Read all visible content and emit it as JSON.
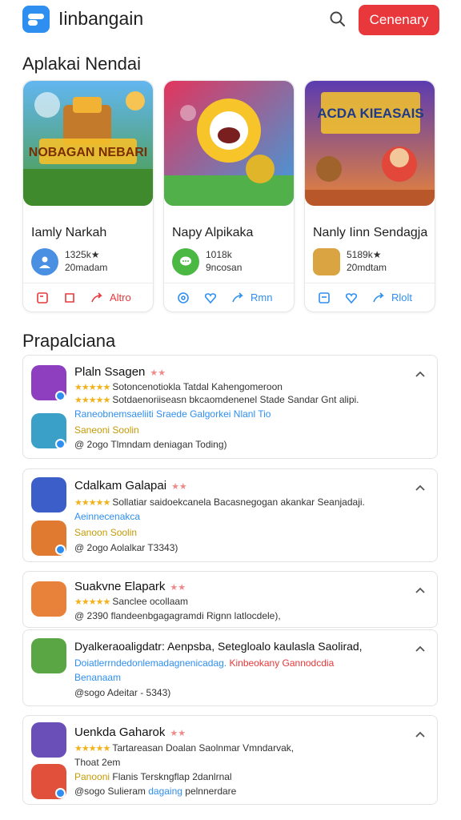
{
  "header": {
    "app_title": "Iinbangain",
    "cta_label": "Cenenary"
  },
  "featured": {
    "title": "Aplakai Nendai",
    "cards": [
      {
        "name": "Iamly Narkah",
        "rating": "1325k★",
        "downloads": "20madam",
        "action_label": "Altro",
        "art_text": "NOBAGAN NEBARI"
      },
      {
        "name": "Napy Alpikaka",
        "rating": "1018k",
        "downloads": "9ncosan",
        "action_label": "Rmn",
        "art_text": ""
      },
      {
        "name": "Nanly Iinn Sendagja",
        "rating": "5189k★",
        "downloads": "20mdtam",
        "action_label": "Rlolt",
        "art_text": "ACDA KIEASAIS"
      }
    ]
  },
  "popular": {
    "title": "Prapalciana",
    "items": [
      {
        "title": "Plaln Ssagen",
        "line1": "Sotoncenotiokla Tatdal Kahengomeroon",
        "line2": "Sotdaenoriiseasn bkcaomdenenel Stade Sandar Gnt alipi.",
        "line3": "Raneobnemsaeliiti Sraede Galgorkei Nlanl Tio",
        "sub_title": "Saneoni Soolin",
        "sub_meta": "@ 2ogo Tlmndam deniagan Toding)"
      },
      {
        "title": "Cdalkam Galapai",
        "line1": "Sollatiar saidoekcanela Bacasnegogan akankar Seanjadaji.",
        "line2": "Aeinnecenakca",
        "sub_title": "Sanoon Soolin",
        "sub_meta": "@ 2ogo Aolalkar T3343)"
      },
      {
        "title": "Suakvne Elapark",
        "line1": "Sanclee ocollaam",
        "sub_meta": "@ 2390 flandeenbgagagramdi Rignn latlocdele),"
      },
      {
        "title": "Dyalkeraoaligdatr: Aenpsba, Setegloalo kaulasla Saolirad,",
        "line1": "Doiatlerrndedonlemadagnenicadag.",
        "line1b": "Kinbeokany Gannodcdia",
        "line2": "Benanaam",
        "sub_meta": "@sogo Adeitar - 5343)"
      },
      {
        "title": "Uenkda Gaharok",
        "line1": "Tartareasan Doalan Saolnmar Vmndarvak,",
        "line2": "Thoat 2em",
        "sub_title": "Panooni",
        "sub_text": "Flanis Terskngflap 2danlrnal",
        "sub_meta_a": "@sogo Sulieram",
        "sub_meta_b": "dagaing",
        "sub_meta_c": "pelnnerdare"
      }
    ]
  },
  "colors": {
    "accent": "#2f8ff0",
    "cta": "#e8383b",
    "star": "#f3b21b"
  }
}
